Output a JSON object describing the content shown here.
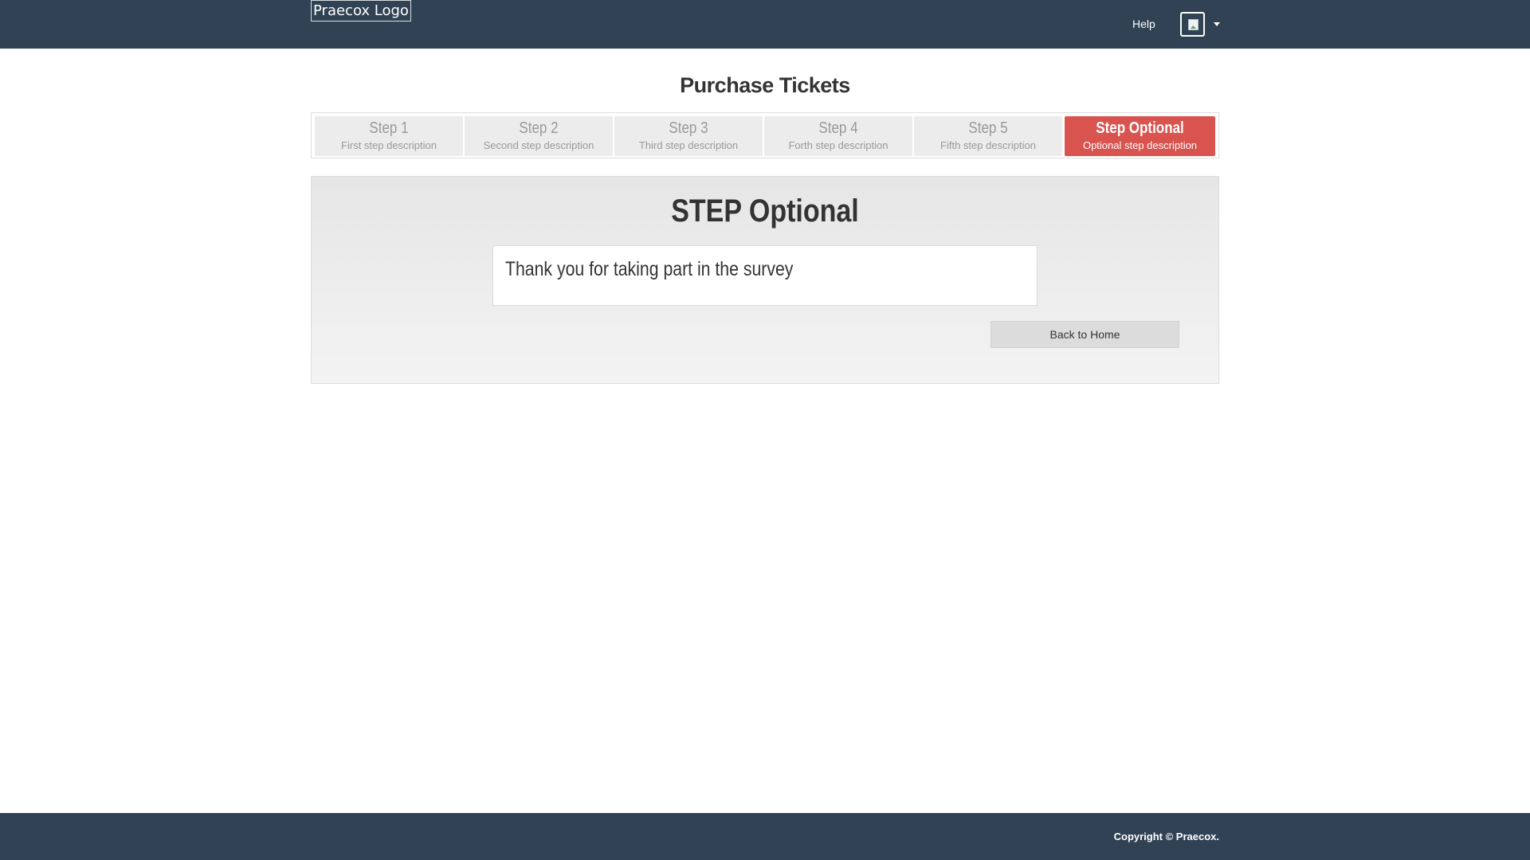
{
  "header": {
    "logo_text": "Praecox Logo",
    "help_label": "Help",
    "avatar_icon": "broken-image-icon",
    "dropdown_icon": "caret-down-icon"
  },
  "page": {
    "title": "Purchase Tickets"
  },
  "steps": [
    {
      "title": "Step 1",
      "description": "First step description",
      "active": false
    },
    {
      "title": "Step 2",
      "description": "Second step description",
      "active": false
    },
    {
      "title": "Step 3",
      "description": "Third step description",
      "active": false
    },
    {
      "title": "Step 4",
      "description": "Forth step description",
      "active": false
    },
    {
      "title": "Step 5",
      "description": "Fifth step description",
      "active": false
    },
    {
      "title": "Step Optional",
      "description": "Optional step description",
      "active": true
    }
  ],
  "panel": {
    "title": "STEP Optional",
    "message": "Thank you for taking part in the survey",
    "back_button_label": "Back to Home"
  },
  "footer": {
    "copyright": "Copyright © Praecox."
  },
  "colors": {
    "navbar": "#304254",
    "active_step": "#d9534f",
    "inactive_step": "#ececec"
  }
}
